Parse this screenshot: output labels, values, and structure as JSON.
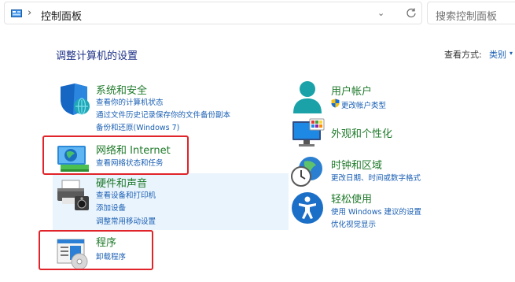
{
  "address_bar": {
    "location_icon": "control-panel-icon",
    "separator": "›",
    "path": "控制面板",
    "dropdown_icon": "chevron-down-icon",
    "refresh_icon": "refresh-icon"
  },
  "search": {
    "placeholder": "搜索控制面板"
  },
  "header": {
    "title": "调整计算机的设置",
    "view_label": "查看方式:",
    "view_value": "类别",
    "view_arrow": "▾"
  },
  "categories_left": [
    {
      "title": "系统和安全",
      "icon": "shield-icon",
      "links": [
        "查看你的计算机状态",
        "通过文件历史记录保存你的文件备份副本",
        "备份和还原(Windows 7)"
      ]
    },
    {
      "title": "网络和 Internet",
      "icon": "network-icon",
      "links": [
        "查看网络状态和任务"
      ]
    },
    {
      "title": "硬件和声音",
      "icon": "printer-icon",
      "links": [
        "查看设备和打印机",
        "添加设备",
        "调整常用移动设置"
      ]
    },
    {
      "title": "程序",
      "icon": "programs-icon",
      "links": [
        "卸载程序"
      ]
    }
  ],
  "categories_right": [
    {
      "title": "用户帐户",
      "icon": "user-icon",
      "links": [
        "更改帐户类型"
      ]
    },
    {
      "title": "外观和个性化",
      "icon": "personalization-icon",
      "links": []
    },
    {
      "title": "时钟和区域",
      "icon": "clock-globe-icon",
      "links": [
        "更改日期、时间或数字格式"
      ]
    },
    {
      "title": "轻松使用",
      "icon": "accessibility-icon",
      "links": [
        "使用 Windows 建议的设置",
        "优化视觉显示"
      ]
    }
  ],
  "colors": {
    "highlight_border": "#e0242a",
    "category_title": "#1e7a2a",
    "link": "#1a5fb4",
    "hover_background": "#eaf4fd"
  }
}
